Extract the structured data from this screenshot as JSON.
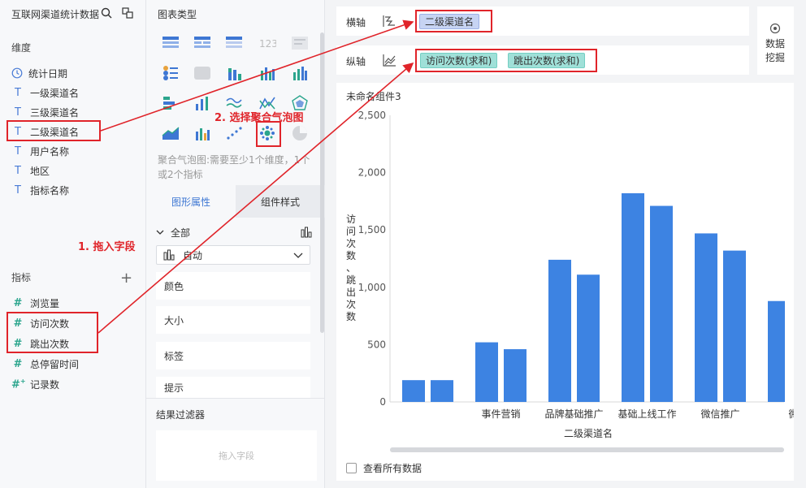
{
  "left_panel": {
    "dataset_title": "互联网渠道统计数据",
    "dimensions_label": "维度",
    "dimensions": [
      {
        "label": "统计日期",
        "icon": "clock-icon"
      },
      {
        "label": "一级渠道名",
        "icon": "text-field-icon"
      },
      {
        "label": "三级渠道名",
        "icon": "text-field-icon"
      },
      {
        "label": "二级渠道名",
        "icon": "text-field-icon"
      },
      {
        "label": "用户名称",
        "icon": "text-field-icon"
      },
      {
        "label": "地区",
        "icon": "text-field-icon"
      },
      {
        "label": "指标名称",
        "icon": "text-field-icon"
      }
    ],
    "metrics_label": "指标",
    "metrics": [
      {
        "label": "浏览量",
        "icon": "number-field-icon"
      },
      {
        "label": "访问次数",
        "icon": "number-field-icon"
      },
      {
        "label": "跳出次数",
        "icon": "number-field-icon"
      },
      {
        "label": "总停留时间",
        "icon": "number-field-icon"
      },
      {
        "label": "记录数",
        "icon": "calculated-number-icon"
      }
    ]
  },
  "annotations": {
    "step1": "1. 拖入字段",
    "step2": "2. 选择聚合气泡图"
  },
  "middle_panel": {
    "chart_type_title": "图表类型",
    "hint": "聚合气泡图:需要至少1个维度，1个或2个指标",
    "tabs": [
      "图形属性",
      "组件样式"
    ],
    "all_label": "全部",
    "select_value": "自动",
    "properties": [
      "颜色",
      "大小",
      "标签",
      "提示"
    ],
    "filter_title": "结果过滤器",
    "filter_placeholder": "拖入字段"
  },
  "axes": {
    "x_label": "横轴",
    "y_label": "纵轴",
    "x_fields": [
      "二级渠道名"
    ],
    "y_fields": [
      "访问次数(求和)",
      "跳出次数(求和)"
    ]
  },
  "data_mining": "数据挖掘",
  "widget": {
    "title": "未命名组件3",
    "show_all_label": "查看所有数据"
  },
  "colors": {
    "bar": "#3d83e2",
    "annotation": "#e0242a",
    "accent": "#3e77d3"
  },
  "chart_data": {
    "type": "bar",
    "categories": [
      "",
      "事件营销",
      "品牌基础推广",
      "基础上线工作",
      "微信推广",
      "微博"
    ],
    "visible_category_labels": [
      "",
      "事件营销",
      "品牌基础推广",
      "基础上线工作",
      "微信推广",
      "微"
    ],
    "series": [
      {
        "name": "访问次数(求和)",
        "values": [
          190,
          520,
          1240,
          1820,
          1470,
          880
        ]
      },
      {
        "name": "跳出次数(求和)",
        "values": [
          190,
          460,
          1110,
          1710,
          1320,
          null
        ]
      }
    ],
    "xlabel": "二级渠道名",
    "ylabel": "访问次数、跳出次数",
    "ylim": [
      0,
      2500
    ],
    "yticks": [
      "0",
      "500",
      "1,000",
      "1,500",
      "2,000",
      "2,500"
    ],
    "grid": false
  }
}
